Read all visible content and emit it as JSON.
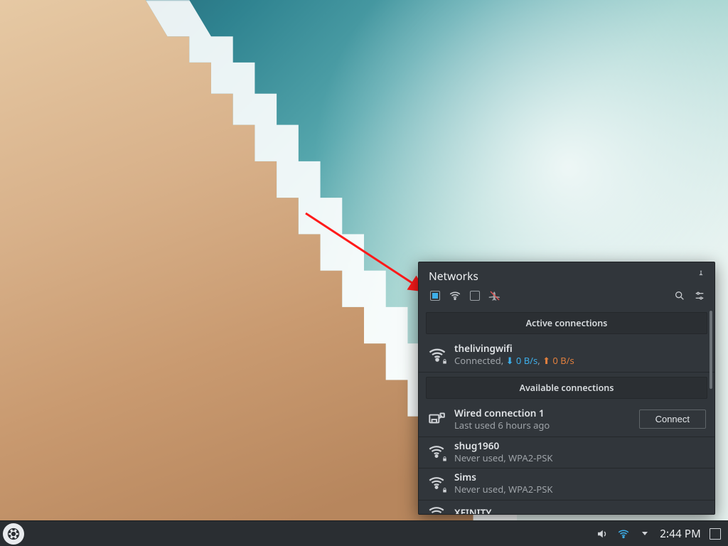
{
  "popup": {
    "title": "Networks",
    "toggles": {
      "networking_enabled": true,
      "wired_enabled": false
    },
    "sections": {
      "active": "Active connections",
      "available": "Available connections"
    },
    "active": {
      "name": "thelivingwifi",
      "status_prefix": "Connected, ",
      "down_rate": "0 B/s",
      "up_rate": "0 B/s"
    },
    "available": [
      {
        "name": "Wired connection 1",
        "sub": "Last used 6 hours ago",
        "kind": "wired",
        "secured": false,
        "has_button": true
      },
      {
        "name": "shug1960",
        "sub": "Never used, WPA2-PSK",
        "kind": "wifi",
        "secured": true,
        "has_button": false
      },
      {
        "name": "Sims",
        "sub": "Never used, WPA2-PSK",
        "kind": "wifi",
        "secured": true,
        "has_button": false
      },
      {
        "name": "XFINITY",
        "sub": "",
        "kind": "wifi",
        "secured": false,
        "has_button": false
      }
    ],
    "connect_label": "Connect"
  },
  "taskbar": {
    "clock": "2:44 PM"
  },
  "colors": {
    "accent": "#3daee9",
    "panel": "#31363b",
    "panel_dark": "#2b2f33"
  }
}
